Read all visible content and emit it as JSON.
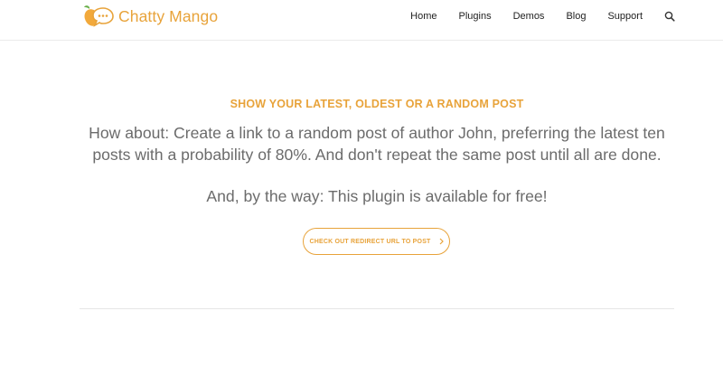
{
  "brand": {
    "name": "Chatty Mango",
    "accent_color": "#e8a33a",
    "leaf_color": "#6ab04c",
    "logo_icon": "mango-chat-bubble-icon"
  },
  "nav": {
    "items": [
      {
        "label": "Home"
      },
      {
        "label": "Plugins"
      },
      {
        "label": "Demos"
      },
      {
        "label": "Blog"
      },
      {
        "label": "Support"
      }
    ],
    "search_icon": "search-icon"
  },
  "main": {
    "eyebrow": "SHOW YOUR LATEST, OLDEST OR A RANDOM POST",
    "lead": "How about: Create a link to a random post of author John, preferring the latest ten posts with a probability of 80%. And don't repeat the same post until all are done.",
    "note": "And, by the way: This plugin is available for free!",
    "cta": {
      "label": "CHECK OUT REDIRECT URL TO POST",
      "icon": "chevron-right-icon"
    }
  }
}
